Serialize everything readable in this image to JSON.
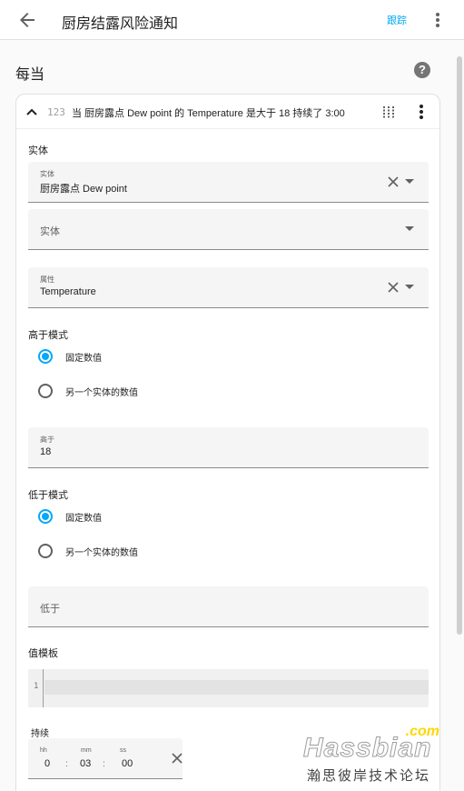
{
  "header": {
    "title": "厨房结露风险通知",
    "track_label": "跟踪"
  },
  "section": {
    "title": "每当",
    "help_glyph": "?"
  },
  "trigger": {
    "type_glyph": "123",
    "summary": "当 厨房露点 Dew point 的 Temperature 是大于 18 持续了 3:00",
    "entity_section_label": "实体",
    "entity_field_1": {
      "label": "实体",
      "value": "厨房露点 Dew point"
    },
    "entity_field_2": {
      "placeholder": "实体"
    },
    "attribute_field": {
      "label": "属性",
      "value": "Temperature"
    },
    "above_mode": {
      "title": "高于模式",
      "options": [
        "固定数值",
        "另一个实体的数值"
      ],
      "selected_index": 0
    },
    "above_field": {
      "label": "高于",
      "value": "18"
    },
    "below_mode": {
      "title": "低于模式",
      "options": [
        "固定数值",
        "另一个实体的数值"
      ],
      "selected_index": 0
    },
    "below_field": {
      "placeholder": "低于"
    },
    "value_template": {
      "title": "值模板",
      "line_number": "1"
    },
    "duration": {
      "title": "持续",
      "units": {
        "hours": "hh",
        "minutes": "mm",
        "seconds": "ss"
      },
      "values": {
        "hours": "0",
        "minutes": "03",
        "seconds": "00"
      },
      "separator": ":"
    }
  },
  "watermark": {
    "tld": ".com",
    "brand": "Hassbian",
    "tagline": "瀚思彼岸技术论坛"
  },
  "colors": {
    "accent": "#03a9f4",
    "field_bg": "#f5f5f5",
    "watermark_gold": "#ffd600"
  }
}
